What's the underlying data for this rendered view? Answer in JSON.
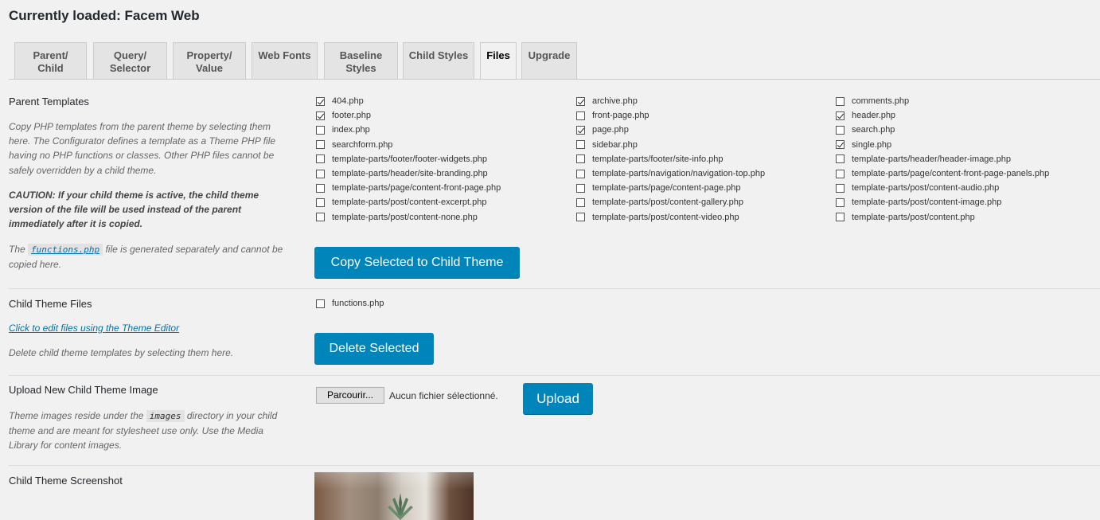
{
  "page": {
    "title": "Currently loaded: Facem Web"
  },
  "tabs": [
    {
      "line1": "Parent/",
      "line2": "Child"
    },
    {
      "line1": "Query/",
      "line2": "Selector"
    },
    {
      "line1": "Property/",
      "line2": "Value"
    },
    {
      "line1": "Web Fonts",
      "line2": ""
    },
    {
      "line1": "Baseline",
      "line2": "Styles"
    },
    {
      "line1": "Child Styles",
      "line2": ""
    },
    {
      "line1": "Files",
      "line2": "",
      "active": true
    },
    {
      "line1": "Upgrade",
      "line2": ""
    }
  ],
  "parent_templates": {
    "title": "Parent Templates",
    "desc1": "Copy PHP templates from the parent theme by selecting them here. The Configurator defines a template as a Theme PHP file having no PHP functions or classes. Other PHP files cannot be safely overridden by a child theme.",
    "caution": "CAUTION: If your child theme is active, the child theme version of the file will be used instead of the parent immediately after it is copied.",
    "note_prefix": "The",
    "note_code": "functions.php",
    "note_suffix": "file is generated separately and cannot be copied here.",
    "button": "Copy Selected to Child Theme",
    "columns": [
      [
        {
          "name": "404.php",
          "checked": true
        },
        {
          "name": "footer.php",
          "checked": true
        },
        {
          "name": "index.php",
          "checked": false
        },
        {
          "name": "searchform.php",
          "checked": false
        },
        {
          "name": "template-parts/footer/footer-widgets.php",
          "checked": false
        },
        {
          "name": "template-parts/header/site-branding.php",
          "checked": false
        },
        {
          "name": "template-parts/page/content-front-page.php",
          "checked": false
        },
        {
          "name": "template-parts/post/content-excerpt.php",
          "checked": false
        },
        {
          "name": "template-parts/post/content-none.php",
          "checked": false
        }
      ],
      [
        {
          "name": "archive.php",
          "checked": true
        },
        {
          "name": "front-page.php",
          "checked": false
        },
        {
          "name": "page.php",
          "checked": true
        },
        {
          "name": "sidebar.php",
          "checked": false
        },
        {
          "name": "template-parts/footer/site-info.php",
          "checked": false
        },
        {
          "name": "template-parts/navigation/navigation-top.php",
          "checked": false
        },
        {
          "name": "template-parts/page/content-page.php",
          "checked": false
        },
        {
          "name": "template-parts/post/content-gallery.php",
          "checked": false
        },
        {
          "name": "template-parts/post/content-video.php",
          "checked": false
        }
      ],
      [
        {
          "name": "comments.php",
          "checked": false
        },
        {
          "name": "header.php",
          "checked": true
        },
        {
          "name": "search.php",
          "checked": false
        },
        {
          "name": "single.php",
          "checked": true
        },
        {
          "name": "template-parts/header/header-image.php",
          "checked": false
        },
        {
          "name": "template-parts/page/content-front-page-panels.php",
          "checked": false
        },
        {
          "name": "template-parts/post/content-audio.php",
          "checked": false
        },
        {
          "name": "template-parts/post/content-image.php",
          "checked": false
        },
        {
          "name": "template-parts/post/content.php",
          "checked": false
        }
      ]
    ]
  },
  "child_files": {
    "title": "Child Theme Files",
    "link": "Click to edit files using the Theme Editor",
    "desc": "Delete child theme templates by selecting them here.",
    "files": [
      {
        "name": "functions.php",
        "checked": false
      }
    ],
    "button": "Delete Selected"
  },
  "upload": {
    "title": "Upload New Child Theme Image",
    "desc_prefix": "Theme images reside under the",
    "desc_code": "images",
    "desc_suffix": "directory in your child theme and are meant for stylesheet use only. Use the Media Library for content images.",
    "browse_label": "Parcourir...",
    "no_file": "Aucun fichier sélectionné.",
    "button": "Upload"
  },
  "screenshot": {
    "title": "Child Theme Screenshot"
  }
}
